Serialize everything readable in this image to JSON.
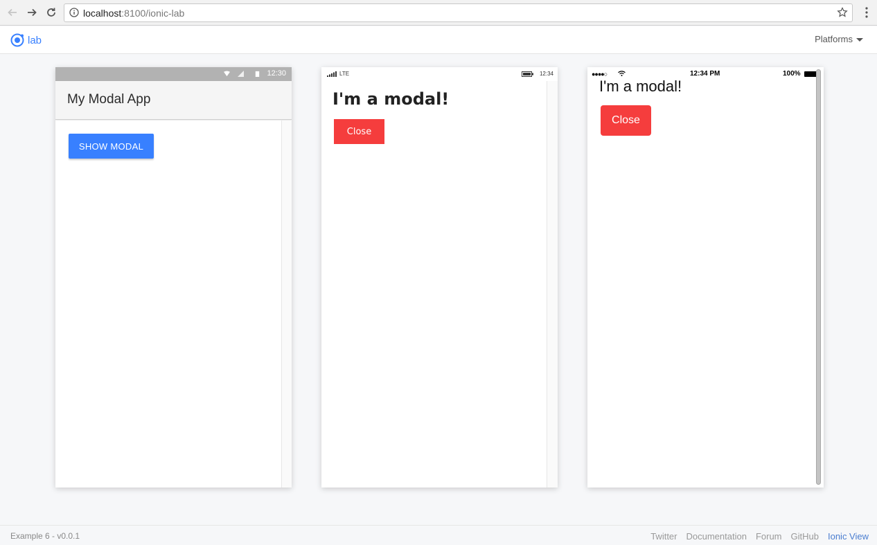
{
  "browser": {
    "url_host": "localhost",
    "url_rest": ":8100/ionic-lab"
  },
  "lab": {
    "logo_text": "lab",
    "platforms_label": "Platforms",
    "accent": "#3880ff"
  },
  "android": {
    "status_time": "12:30",
    "title": "My Modal App",
    "show_modal_label": "SHOW MODAL"
  },
  "windows": {
    "network": "LTE",
    "status_time": "12:34",
    "modal_title": "I'm a modal!",
    "close_label": "Close"
  },
  "ios": {
    "carrier": "●●●●○",
    "status_time": "12:34 PM",
    "battery": "100%",
    "modal_title": "I'm a modal!",
    "close_label": "Close"
  },
  "footer": {
    "version": "Example 6 - v0.0.1",
    "links": [
      "Twitter",
      "Documentation",
      "Forum",
      "GitHub",
      "Ionic View"
    ]
  },
  "colors": {
    "danger": "#f53d3d",
    "primary": "#3880ff"
  }
}
